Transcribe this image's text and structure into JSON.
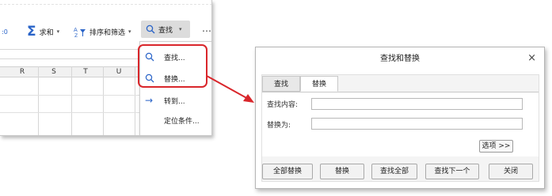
{
  "ribbon": {
    "sum_label": "求和",
    "sort_filter_label": "排序和筛选",
    "find_label": "查找",
    "more_label": "⋯"
  },
  "columns": [
    "R",
    "S",
    "T",
    "U"
  ],
  "find_menu": {
    "items": [
      {
        "label": "查找...",
        "icon": "search-icon"
      },
      {
        "label": "替换...",
        "icon": "search-icon"
      },
      {
        "label": "转到...",
        "icon": "arrow-right-icon"
      },
      {
        "label": "定位条件...",
        "icon": ""
      }
    ]
  },
  "dialog": {
    "title": "查找和替换",
    "close_symbol": "×",
    "tabs": [
      "查找",
      "替换"
    ],
    "active_tab": "替换",
    "find_label": "查找内容:",
    "find_value": "",
    "replace_label": "替换为:",
    "replace_value": "",
    "options_label": "选项 >>",
    "buttons": [
      "全部替换",
      "替换",
      "查找全部",
      "查找下一个",
      "关闭"
    ]
  },
  "colors": {
    "accent_blue": "#2a64c8",
    "highlight_red": "#d9262b"
  }
}
